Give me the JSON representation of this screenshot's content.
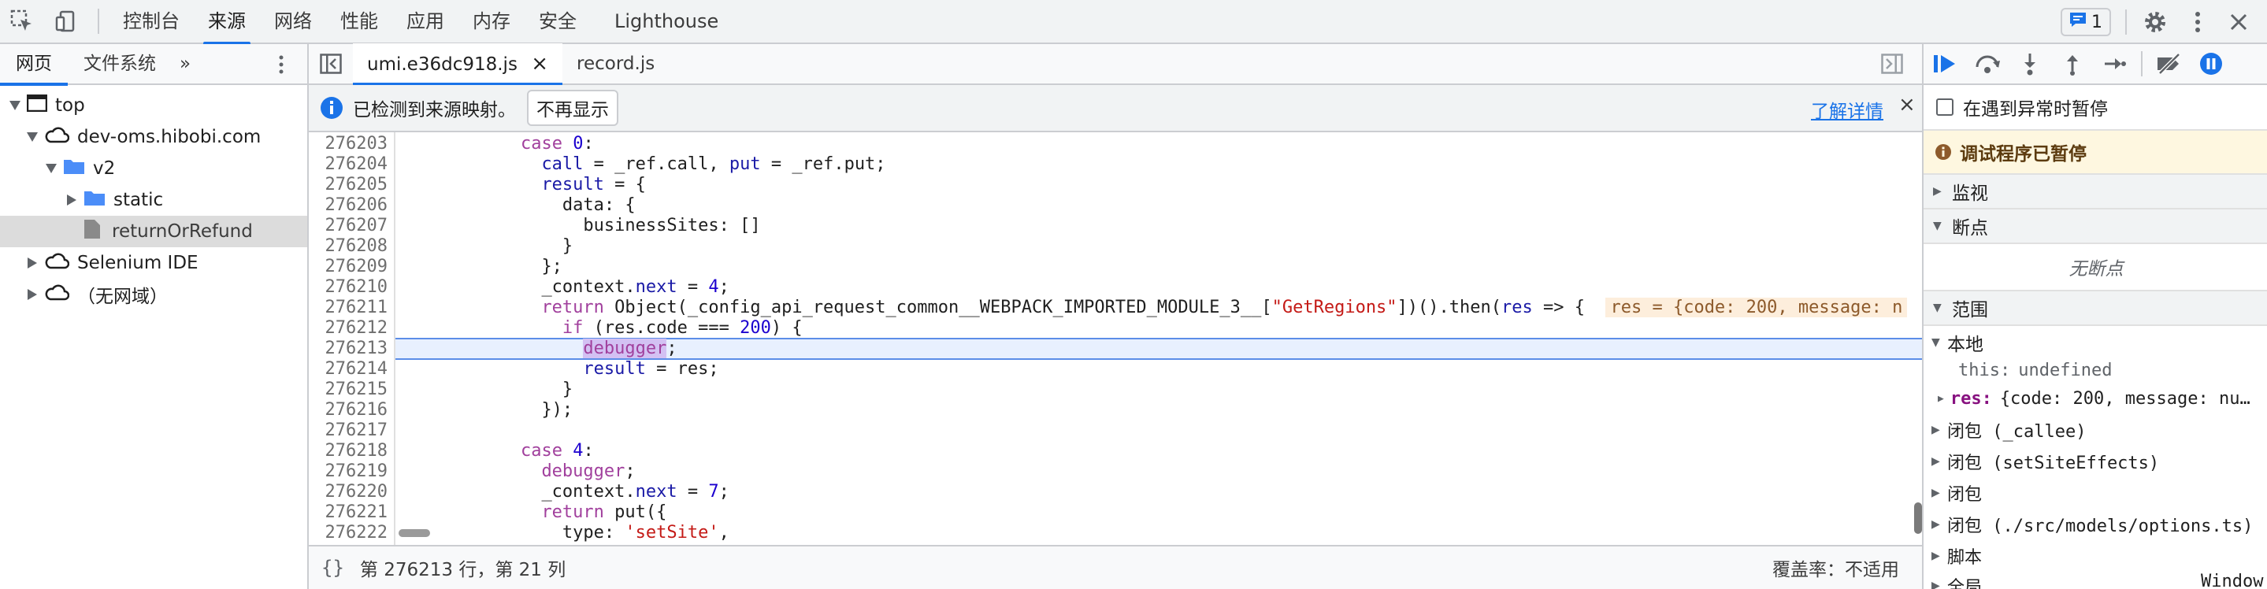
{
  "toolbar": {
    "tabs": [
      "控制台",
      "来源",
      "网络",
      "性能",
      "应用",
      "内存",
      "安全",
      "Lighthouse"
    ],
    "active_tab": "来源",
    "issues_count": "1"
  },
  "left": {
    "tabs": [
      "网页",
      "文件系统"
    ],
    "more": "»",
    "tree": [
      {
        "label": "top"
      },
      {
        "label": "dev-oms.hibobi.com"
      },
      {
        "label": "v2"
      },
      {
        "label": "static"
      },
      {
        "label": "returnOrRefund"
      },
      {
        "label": "Selenium IDE"
      },
      {
        "label": "（无网域）"
      }
    ]
  },
  "editor": {
    "tabs": [
      {
        "label": "umi.e36dc918.js",
        "close": "×"
      },
      {
        "label": "record.js"
      }
    ],
    "infobar": {
      "message": "已检测到来源映射。",
      "dismiss": "不再显示",
      "learn_more": "了解详情",
      "close": "×"
    },
    "line_numbers": [
      "276203",
      "276204",
      "276205",
      "276206",
      "276207",
      "276208",
      "276209",
      "276210",
      "276211",
      "276212",
      "276213",
      "276214",
      "276215",
      "276216",
      "276217",
      "276218",
      "276219",
      "276220",
      "276221",
      "276222"
    ],
    "lines": [
      {
        "indent": "            ",
        "tokens": [
          {
            "t": "case ",
            "c": "kw"
          },
          {
            "t": "0",
            "c": "num"
          },
          {
            "t": ":",
            "c": ""
          }
        ]
      },
      {
        "indent": "              ",
        "tokens": [
          {
            "t": "call",
            "c": "id"
          },
          {
            "t": " = _ref.call, ",
            "c": ""
          },
          {
            "t": "put",
            "c": "id"
          },
          {
            "t": " = _ref.put;",
            "c": ""
          }
        ]
      },
      {
        "indent": "              ",
        "tokens": [
          {
            "t": "result",
            "c": "id"
          },
          {
            "t": " = {",
            "c": ""
          }
        ]
      },
      {
        "indent": "                ",
        "tokens": [
          {
            "t": "data: {",
            "c": ""
          }
        ]
      },
      {
        "indent": "                  ",
        "tokens": [
          {
            "t": "businessSites: []",
            "c": ""
          }
        ]
      },
      {
        "indent": "                ",
        "tokens": [
          {
            "t": "}",
            "c": ""
          }
        ]
      },
      {
        "indent": "              ",
        "tokens": [
          {
            "t": "};",
            "c": ""
          }
        ]
      },
      {
        "indent": "              ",
        "tokens": [
          {
            "t": "_context.",
            "c": ""
          },
          {
            "t": "next",
            "c": "id"
          },
          {
            "t": " = ",
            "c": ""
          },
          {
            "t": "4",
            "c": "num"
          },
          {
            "t": ";",
            "c": ""
          }
        ]
      },
      {
        "indent": "              ",
        "tokens": [
          {
            "t": "return ",
            "c": "kw"
          },
          {
            "t": "Object(_config_api_request_common__WEBPACK_IMPORTED_MODULE_3__[",
            "c": ""
          },
          {
            "t": "\"GetRegions\"",
            "c": "str"
          },
          {
            "t": "])().then(",
            "c": ""
          },
          {
            "t": "res",
            "c": "id"
          },
          {
            "t": " => {  ",
            "c": ""
          },
          {
            "t": "res = {code: 200, message: n",
            "c": "inline-val"
          }
        ]
      },
      {
        "indent": "                ",
        "tokens": [
          {
            "t": "if ",
            "c": "kw"
          },
          {
            "t": "(res.code === ",
            "c": ""
          },
          {
            "t": "200",
            "c": "num"
          },
          {
            "t": ") {",
            "c": ""
          }
        ]
      },
      {
        "indent": "                  ",
        "tokens": [
          {
            "t": "debugger",
            "c": "kw dbg-hl"
          },
          {
            "t": ";",
            "c": ""
          }
        ]
      },
      {
        "indent": "                  ",
        "tokens": [
          {
            "t": "result",
            "c": "id"
          },
          {
            "t": " = res;",
            "c": ""
          }
        ]
      },
      {
        "indent": "                ",
        "tokens": [
          {
            "t": "}",
            "c": ""
          }
        ]
      },
      {
        "indent": "              ",
        "tokens": [
          {
            "t": "});",
            "c": ""
          }
        ]
      },
      {
        "indent": "",
        "tokens": []
      },
      {
        "indent": "            ",
        "tokens": [
          {
            "t": "case ",
            "c": "kw"
          },
          {
            "t": "4",
            "c": "num"
          },
          {
            "t": ":",
            "c": ""
          }
        ]
      },
      {
        "indent": "              ",
        "tokens": [
          {
            "t": "debugger",
            "c": "kw"
          },
          {
            "t": ";",
            "c": ""
          }
        ]
      },
      {
        "indent": "              ",
        "tokens": [
          {
            "t": "_context.",
            "c": ""
          },
          {
            "t": "next",
            "c": "id"
          },
          {
            "t": " = ",
            "c": ""
          },
          {
            "t": "7",
            "c": "num"
          },
          {
            "t": ";",
            "c": ""
          }
        ]
      },
      {
        "indent": "              ",
        "tokens": [
          {
            "t": "return ",
            "c": "kw"
          },
          {
            "t": "put({",
            "c": ""
          }
        ]
      },
      {
        "indent": "                ",
        "tokens": [
          {
            "t": "type: ",
            "c": ""
          },
          {
            "t": "'setSite'",
            "c": "str"
          },
          {
            "t": ",",
            "c": ""
          }
        ]
      }
    ],
    "highlighted_line_index": 10,
    "status": {
      "braces": "{}",
      "position": "第 276213 行，第 21 列",
      "coverage": "覆盖率：不适用"
    }
  },
  "debugger": {
    "pause_on_exceptions": "在遇到异常时暂停",
    "paused_banner": "调试程序已暂停",
    "watch": "监视",
    "breakpoints": "断点",
    "no_breakpoints": "无断点",
    "scope": "范围",
    "local": "本地",
    "this_key": "this:",
    "this_val": "undefined",
    "res_key": "res:",
    "res_val": "{code: 200, message: nu…",
    "closures": [
      "闭包 (_callee)",
      "闭包 (setSiteEffects)",
      "闭包",
      "闭包 (./src/models/options.ts)"
    ],
    "script": "脚本",
    "global": "全局",
    "global_val": "Window"
  },
  "colors": {
    "accent": "#1a73e8",
    "paused_bg": "#fef7e0",
    "highlight_line": "#e8f0fe"
  }
}
